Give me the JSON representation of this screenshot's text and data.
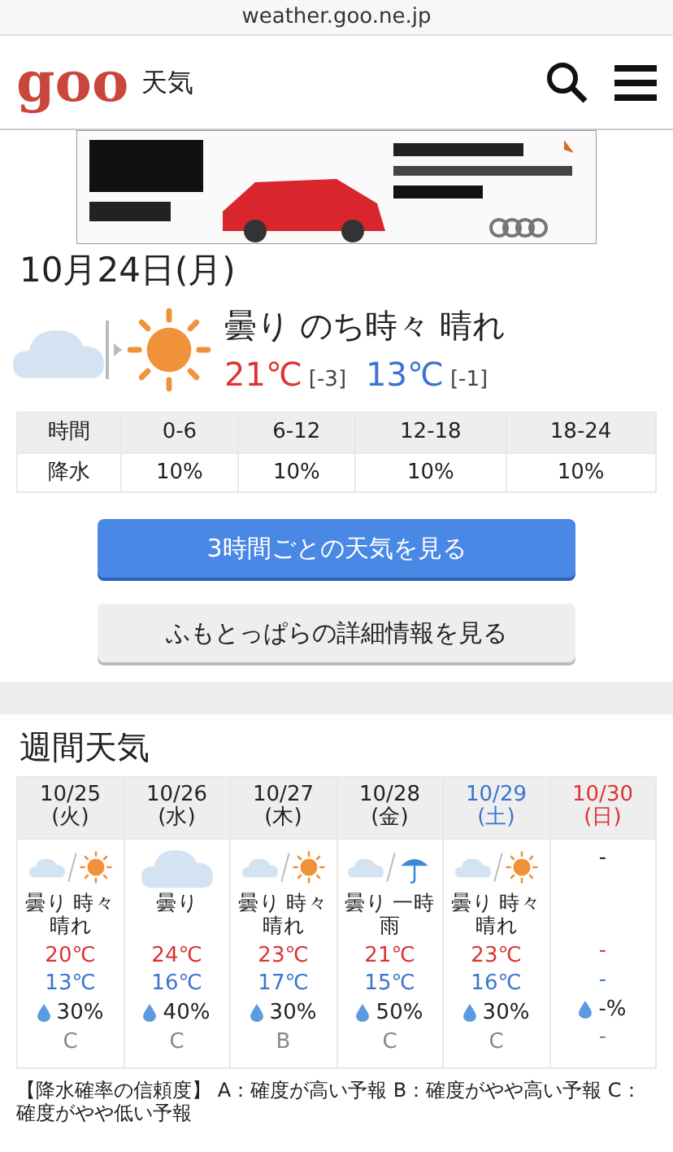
{
  "browser": {
    "url": "weather.goo.ne.jp"
  },
  "header": {
    "logo": "goo",
    "section": "天気"
  },
  "today": {
    "date": "10月24日(月)",
    "icons": [
      {
        "kind": "cloudy"
      },
      {
        "kind": "sunny"
      }
    ],
    "summary": "曇り のち時々 晴れ",
    "high": "21℃",
    "high_diff": "[-3]",
    "low": "13℃",
    "low_diff": "[-1]",
    "table": {
      "columns": [
        "時間",
        "0-6",
        "6-12",
        "12-18",
        "18-24"
      ],
      "rows": [
        [
          "降水",
          "10%",
          "10%",
          "10%",
          "10%"
        ]
      ]
    }
  },
  "buttons": [
    {
      "label": "3時間ごとの天気を見る",
      "kind": "primary"
    },
    {
      "label": "ふもとっぱらの詳細情報を見る",
      "kind": "secondary"
    }
  ],
  "weekly": {
    "title": "週間天気",
    "days": [
      {
        "date": "10/25",
        "weekday": "(火)",
        "kind": "weekday",
        "icons": [
          {
            "kind": "cloudy"
          },
          {
            "kind": "sunny"
          }
        ],
        "weather": "曇り 時々晴れ",
        "high": "20℃",
        "low": "13℃",
        "rain": "30%",
        "reliability": "C"
      },
      {
        "date": "10/26",
        "weekday": "(水)",
        "kind": "weekday",
        "icons": [
          {
            "kind": "cloudy"
          }
        ],
        "weather": "曇り",
        "high": "24℃",
        "low": "16℃",
        "rain": "40%",
        "reliability": "C"
      },
      {
        "date": "10/27",
        "weekday": "(木)",
        "kind": "weekday",
        "icons": [
          {
            "kind": "cloudy"
          },
          {
            "kind": "sunny"
          }
        ],
        "weather": "曇り 時々晴れ",
        "high": "23℃",
        "low": "17℃",
        "rain": "30%",
        "reliability": "B"
      },
      {
        "date": "10/28",
        "weekday": "(金)",
        "kind": "weekday",
        "icons": [
          {
            "kind": "cloudy"
          },
          {
            "kind": "rain"
          }
        ],
        "weather": "曇り 一時雨",
        "high": "21℃",
        "low": "15℃",
        "rain": "50%",
        "reliability": "C"
      },
      {
        "date": "10/29",
        "weekday": "(土)",
        "kind": "saturday",
        "icons": [
          {
            "kind": "cloudy"
          },
          {
            "kind": "sunny"
          }
        ],
        "weather": "曇り 時々晴れ",
        "high": "23℃",
        "low": "16℃",
        "rain": "30%",
        "reliability": "C"
      },
      {
        "date": "10/30",
        "weekday": "(日)",
        "kind": "sunday",
        "icon_text": "-",
        "high": "-",
        "low": "-",
        "rain": "-%",
        "reliability": "-"
      }
    ],
    "note": "【降水確率の信頼度】 A：確度が高い予報 B：確度がやや高い予報 C：確度がやや低い予報"
  }
}
